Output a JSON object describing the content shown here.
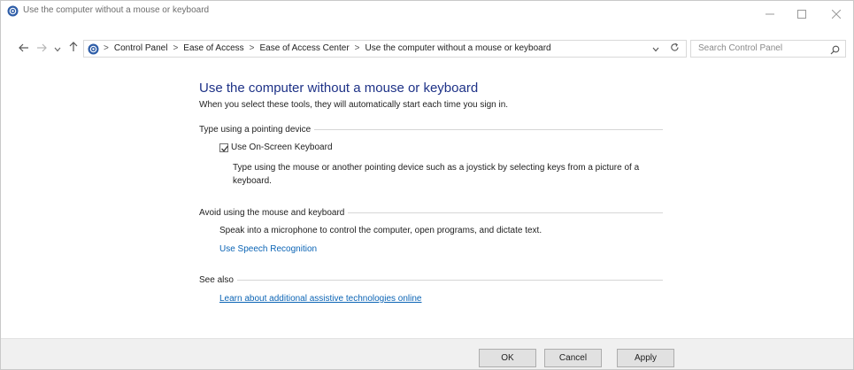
{
  "window": {
    "title": "Use the computer without a mouse or keyboard",
    "controls": {
      "minimize": "minimize-icon",
      "maximize": "maximize-icon",
      "close": "close-icon"
    }
  },
  "nav": {
    "icons": [
      "back-arrow-icon",
      "forward-arrow-icon",
      "recent-locations-icon",
      "up-arrow-icon"
    ],
    "breadcrumbs": [
      "Control Panel",
      "Ease of Access",
      "Ease of Access Center",
      "Use the computer without a mouse or keyboard"
    ],
    "separator": ">",
    "search_placeholder": "Search Control Panel"
  },
  "page": {
    "title": "Use the computer without a mouse or keyboard",
    "subtitle": "When you select these tools, they will automatically start each time you sign in.",
    "sections": [
      {
        "heading": "Type using a pointing device",
        "checkbox_label": "Use On-Screen Keyboard",
        "checkbox_checked": true,
        "description": "Type using the mouse or another pointing device such as a joystick by selecting keys from a picture of a keyboard."
      },
      {
        "heading": "Avoid using the mouse and keyboard",
        "description": "Speak into a microphone to control the computer, open programs, and dictate text.",
        "link": "Use Speech Recognition"
      },
      {
        "heading": "See also",
        "link": "Learn about additional assistive technologies online"
      }
    ]
  },
  "footer": {
    "ok": "OK",
    "cancel": "Cancel",
    "apply": "Apply"
  },
  "colors": {
    "title_blue": "#1e3287",
    "link_blue": "#0b64b5",
    "footer_bg": "#f0f0f0"
  }
}
